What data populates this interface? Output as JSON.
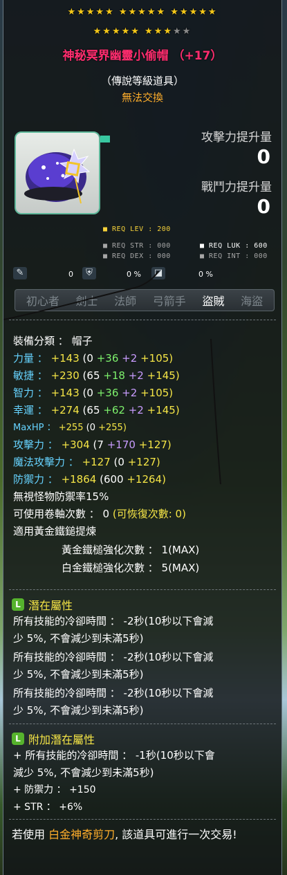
{
  "item": {
    "star_rows": [
      {
        "filled": "★★★★★ ★★★★★ ★★★★★",
        "empty": ""
      },
      {
        "filled": "★★★★★ ★★★",
        "empty": "★★"
      }
    ],
    "name": "神秘冥界幽靈小偷帽 （+17）",
    "grade": "（傳說等級道具）",
    "trade_status": "無法交換",
    "attack_increase_label": "攻擊力提升量",
    "attack_increase_value": "0",
    "combat_increase_label": "戰鬥力提升量",
    "combat_increase_value": "0"
  },
  "requirements": {
    "req_lev": "■ REQ LEV : 200",
    "req_str": "■ REQ STR : 000",
    "req_luk": "■ REQ LUK : 600",
    "req_dex": "■ REQ DEX : 000",
    "req_int": "■ REQ INT : 000"
  },
  "conditions": [
    {
      "icon": "fire-icon",
      "value": ""
    },
    {
      "icon": "shield-icon",
      "value": "0"
    },
    {
      "icon": "percent-icon",
      "value": "0 %"
    },
    {
      "icon": "badge-icon",
      "value": "0 %"
    }
  ],
  "jobs": [
    {
      "label": "初心者",
      "active": false
    },
    {
      "label": "劍士",
      "active": false
    },
    {
      "label": "法師",
      "active": false
    },
    {
      "label": "弓箭手",
      "active": false
    },
    {
      "label": "盜賊",
      "active": true
    },
    {
      "label": "海盜",
      "active": false
    }
  ],
  "stats": {
    "category": {
      "label": "裝備分類 ：",
      "value": "帽子"
    },
    "str": {
      "label": "力量 ：",
      "total": "+143",
      "open": "(0",
      "a": "+36",
      "b": "+2",
      "c": "+105)"
    },
    "dex": {
      "label": "敏捷 ：",
      "total": "+230",
      "open": "(65",
      "a": "+18",
      "b": "+2",
      "c": "+145)"
    },
    "int": {
      "label": "智力 ：",
      "total": "+143",
      "open": "(0",
      "a": "+36",
      "b": "+2",
      "c": "+105)"
    },
    "luk": {
      "label": "幸運 ：",
      "total": "+274",
      "open": "(65",
      "a": "+62",
      "b": "+2",
      "c": "+145)"
    },
    "maxhp": {
      "label": "MaxHP ：",
      "total": "+255",
      "open": "(0",
      "c": "+255)"
    },
    "atk": {
      "label": "攻擊力 ：",
      "total": "+304",
      "open": "(7",
      "a": "+170",
      "c": "+127)"
    },
    "matk": {
      "label": "魔法攻擊力 ：",
      "total": "+127",
      "open": "(0",
      "c": "+127)"
    },
    "def": {
      "label": "防禦力 ：",
      "total": "+1864",
      "open": "(600",
      "c": "+1264)"
    },
    "ignore_def": "無視怪物防禦率15%",
    "upgrades": {
      "label": "可使用卷軸次數 ： 0",
      "recover": "(可恢復次數: 0)"
    },
    "golden_hammer": "適用黃金鐵鎚提煉",
    "gold_hammer_count": "黃金鐵槌強化次數 ： 1(MAX)",
    "white_hammer_count": "白金鐵槌強化次數 ： 5(MAX)"
  },
  "potential": {
    "title": "潛在屬性",
    "lines": [
      "所有技能的冷卻時間 ： -2秒(10秒以下會減",
      "少 5%, 不會減少到未滿5秒)",
      "所有技能的冷卻時間 ： -2秒(10秒以下會減",
      "少 5%, 不會減少到未滿5秒)",
      "所有技能的冷卻時間 ： -2秒(10秒以下會減",
      "少 5%, 不會減少到未滿5秒)"
    ]
  },
  "bonus_potential": {
    "title": "附加潛在屬性",
    "lines": [
      "+ 所有技能的冷卻時間 ： -1秒(10秒以下會",
      "減少 5%, 不會減少到未滿5秒)",
      "+ 防禦力 ： +150",
      "+ STR ： +6%"
    ]
  },
  "trade_note": {
    "prefix": "若使用",
    "item": "白金神奇剪刀",
    "suffix": ", 該道具可進行一次交易!"
  },
  "colors": {
    "title": "#ff2d6f",
    "star": "#f4c719",
    "gold": "#ffae2b",
    "cyan_label": "#66d3ff",
    "yellow": "#f5e546",
    "green": "#7df06c",
    "purple": "#c99cff"
  }
}
